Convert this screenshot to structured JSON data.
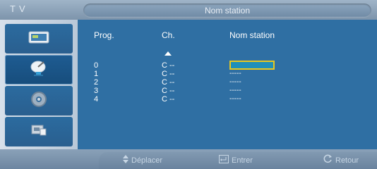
{
  "header": {
    "tv_label": "TV",
    "title": "Nom station"
  },
  "sidebar": {
    "items": [
      {
        "icon": "picture-icon"
      },
      {
        "icon": "satellite-dish-icon",
        "active": true
      },
      {
        "icon": "setup-gear-icon"
      },
      {
        "icon": "input-icon"
      }
    ]
  },
  "table": {
    "headers": {
      "prog": "Prog.",
      "ch": "Ch.",
      "name": "Nom station"
    },
    "rows": [
      {
        "prog": "0",
        "ch": "C --",
        "name": ""
      },
      {
        "prog": "1",
        "ch": "C --",
        "name": "-----"
      },
      {
        "prog": "2",
        "ch": "C --",
        "name": "-----"
      },
      {
        "prog": "3",
        "ch": "C --",
        "name": "-----"
      },
      {
        "prog": "4",
        "ch": "C --",
        "name": "-----"
      }
    ]
  },
  "footer": {
    "move": "Déplacer",
    "enter": "Entrer",
    "back": "Retour"
  },
  "colors": {
    "background": "#2f6fa3",
    "highlight_border": "#e8c81f"
  }
}
